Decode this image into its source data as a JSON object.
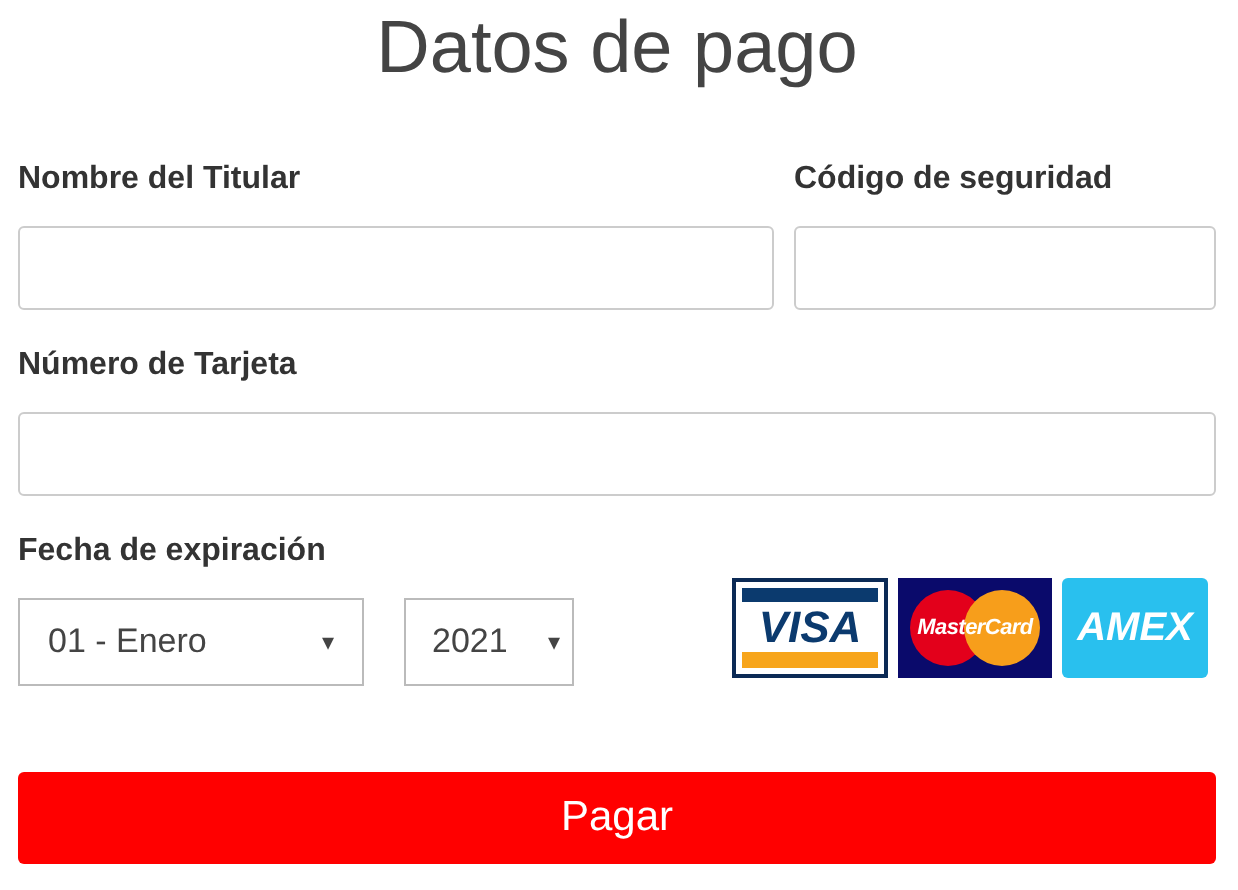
{
  "title": "Datos de pago",
  "holder": {
    "label": "Nombre del Titular"
  },
  "security_code": {
    "label": "Código de seguridad"
  },
  "card_number": {
    "label": "Número de Tarjeta"
  },
  "expiry": {
    "label": "Fecha de expiración",
    "month": "01 - Enero",
    "year": "2021",
    "arrow": "▾"
  },
  "cards": [
    {
      "kind": "visa",
      "name": "VISA"
    },
    {
      "kind": "mastercard",
      "name": "MasterCard"
    },
    {
      "kind": "amex",
      "name": "AMEX"
    }
  ],
  "submit": "Pagar"
}
